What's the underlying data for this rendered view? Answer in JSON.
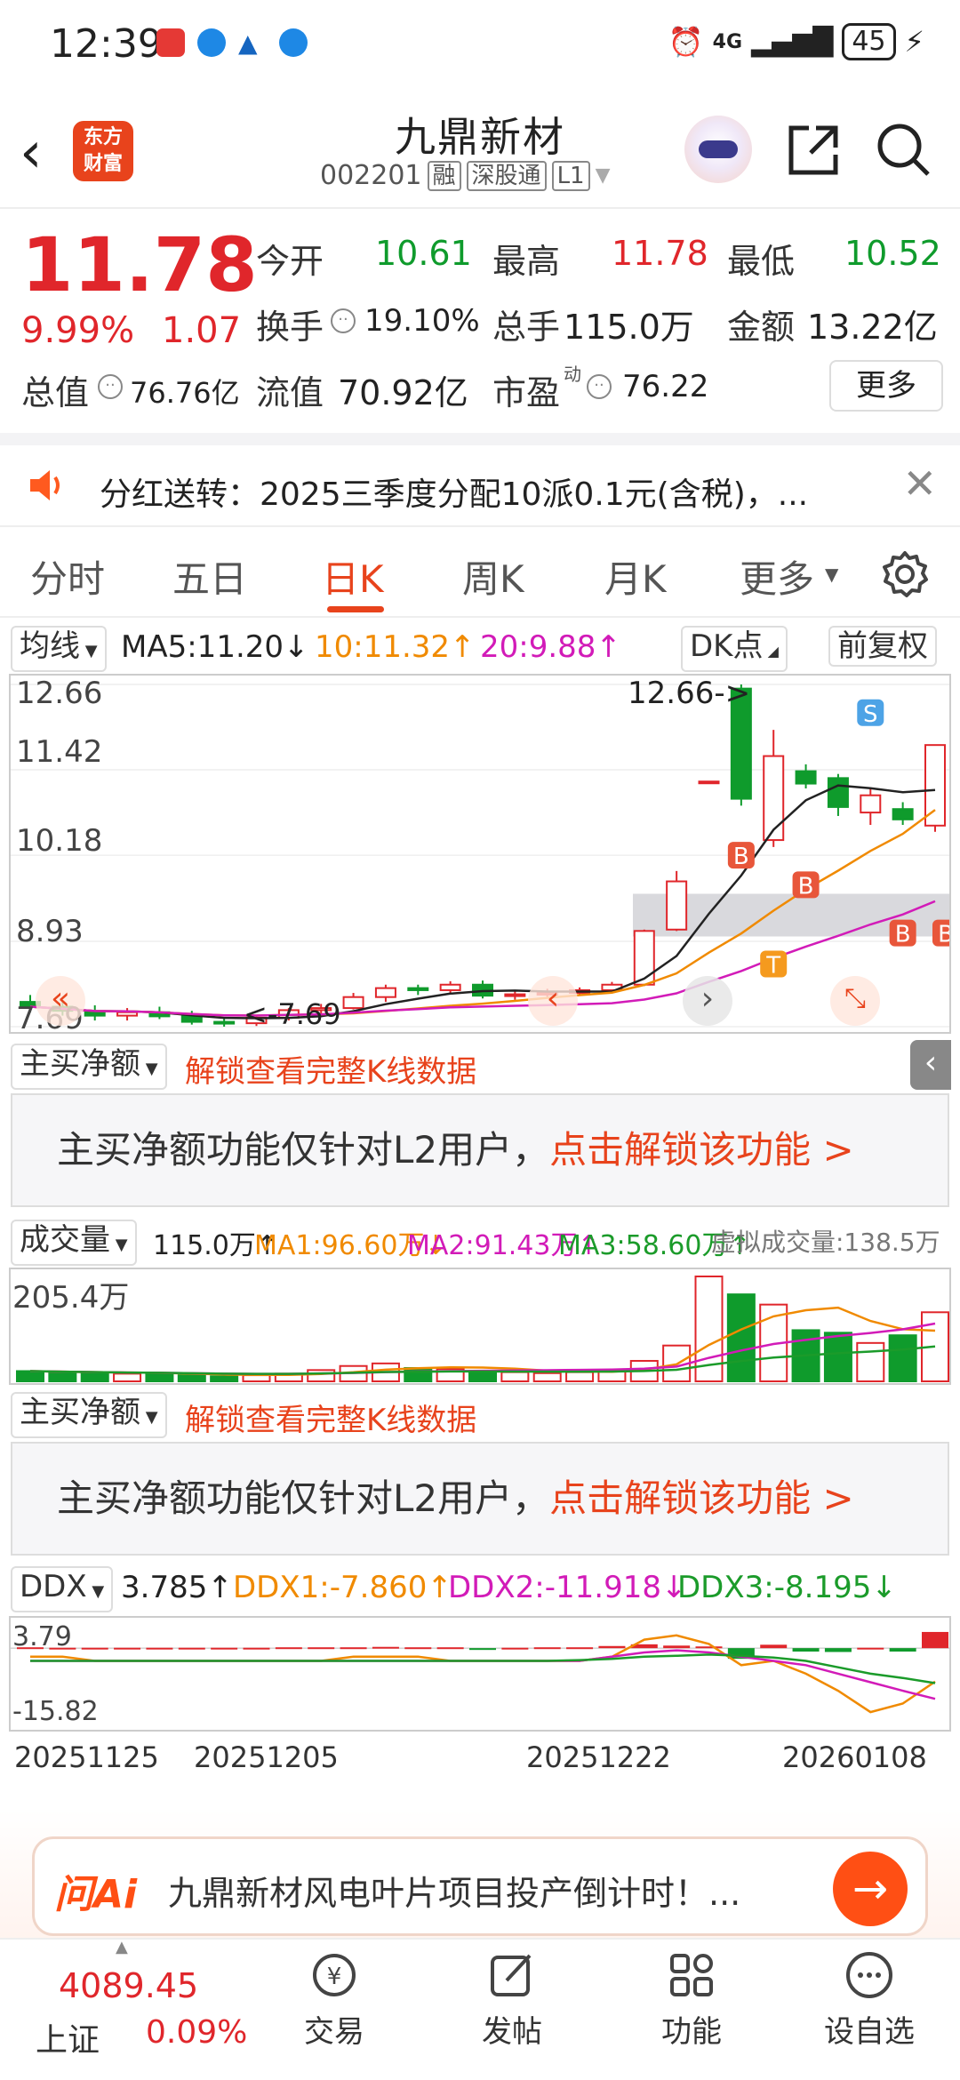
{
  "status_bar": {
    "time": "12:39",
    "network": "4G",
    "battery": "45"
  },
  "header": {
    "title": "九鼎新材",
    "code": "002201",
    "tags": [
      "融",
      "深股通",
      "L1"
    ],
    "logo_text": "东方\n财富"
  },
  "quote": {
    "price": "11.78",
    "change_pct": "9.99%",
    "change": "1.07",
    "open_label": "今开",
    "open": "10.61",
    "high_label": "最高",
    "high": "11.78",
    "low_label": "最低",
    "low": "10.52",
    "turnover_label": "换手",
    "turnover": "19.10%",
    "volume_label": "总手",
    "volume": "115.0万",
    "amount_label": "金额",
    "amount": "13.22亿",
    "mktcap_label": "总值",
    "mktcap": "76.76亿",
    "float_label": "流值",
    "float_cap": "70.92亿",
    "pe_label": "市盈",
    "pe_sup": "动",
    "pe": "76.22",
    "more_label": "更多"
  },
  "dividend": {
    "text": "分红送转：2025三季度分配10派0.1元(含税)，..."
  },
  "tabs": [
    {
      "label": "分时"
    },
    {
      "label": "五日"
    },
    {
      "label": "日K"
    },
    {
      "label": "周K"
    },
    {
      "label": "月K"
    },
    {
      "label": "更多"
    }
  ],
  "ma": {
    "selector": "均线",
    "ma5": "MA5:11.20↓",
    "ma10": "10:11.32↑",
    "ma20": "20:9.88↑",
    "dk_label": "DK点",
    "adjust_label": "前复权"
  },
  "kchart": {
    "y_ticks": [
      "12.66",
      "11.42",
      "10.18",
      "8.93",
      "7.69"
    ],
    "high_annotation": "12.66->",
    "low_annotation": "<-7.69",
    "markers": [
      "B",
      "B",
      "B",
      "S",
      "T",
      "B"
    ]
  },
  "main_net": {
    "selector": "主买净额",
    "unlock_link": "解锁查看完整K线数据",
    "panel_text": "主买净额功能仅针对L2用户，",
    "panel_link": "点击解锁该功能 >"
  },
  "volume": {
    "selector": "成交量",
    "value": "115.0万↑",
    "ma1": "MA1:96.60万↓",
    "ma2": "MA2:91.43万↑",
    "ma3": "MA3:58.60万↑",
    "virtual": "虚拟成交量:138.5万",
    "y_top": "205.4万"
  },
  "main_net2": {
    "selector": "主买净额",
    "unlock_link": "解锁查看完整K线数据",
    "panel_text": "主买净额功能仅针对L2用户，",
    "panel_link": "点击解锁该功能 >"
  },
  "ddx": {
    "selector": "DDX",
    "value": "3.785↑",
    "ddx1": "DDX1:-7.860↑",
    "ddx2": "DDX2:-11.918↓",
    "ddx3": "DDX3:-8.195↓",
    "y_top": "3.79",
    "y_bottom": "-15.82",
    "dates": [
      "20251125",
      "20251205",
      "20251222",
      "20260108"
    ]
  },
  "ai_bar": {
    "logo": "问Ai",
    "text": "九鼎新材风电叶片项目投产倒计时！..."
  },
  "bottom_nav": {
    "index_value": "4089.45",
    "index_name": "上证",
    "index_pct": "0.09%",
    "items": [
      {
        "label": "交易"
      },
      {
        "label": "发帖"
      },
      {
        "label": "功能"
      },
      {
        "label": "设自选"
      }
    ]
  },
  "colors": {
    "up": "#e0262b",
    "down": "#0f9b2c",
    "accent": "#e8431c",
    "ma10": "#f08a00",
    "ma20": "#d21bb8"
  },
  "chart_data": {
    "type": "candlestick",
    "y_range": [
      7.69,
      12.66
    ],
    "price_ticks": [
      12.66,
      11.42,
      10.18,
      8.93,
      7.69
    ],
    "candles": [
      {
        "o": 8.05,
        "h": 8.15,
        "l": 7.9,
        "c": 7.98
      },
      {
        "o": 7.98,
        "h": 8.06,
        "l": 7.85,
        "c": 7.92
      },
      {
        "o": 7.9,
        "h": 8.0,
        "l": 7.78,
        "c": 7.85
      },
      {
        "o": 7.85,
        "h": 7.96,
        "l": 7.78,
        "c": 7.9
      },
      {
        "o": 7.9,
        "h": 7.98,
        "l": 7.8,
        "c": 7.84
      },
      {
        "o": 7.84,
        "h": 7.92,
        "l": 7.72,
        "c": 7.76
      },
      {
        "o": 7.76,
        "h": 7.82,
        "l": 7.69,
        "c": 7.74
      },
      {
        "o": 7.74,
        "h": 7.85,
        "l": 7.7,
        "c": 7.82
      },
      {
        "o": 7.82,
        "h": 7.96,
        "l": 7.78,
        "c": 7.93
      },
      {
        "o": 7.93,
        "h": 8.02,
        "l": 7.86,
        "c": 7.96
      },
      {
        "o": 7.96,
        "h": 8.18,
        "l": 7.94,
        "c": 8.12
      },
      {
        "o": 8.12,
        "h": 8.3,
        "l": 8.05,
        "c": 8.25
      },
      {
        "o": 8.25,
        "h": 8.3,
        "l": 8.15,
        "c": 8.22
      },
      {
        "o": 8.22,
        "h": 8.35,
        "l": 8.18,
        "c": 8.3
      },
      {
        "o": 8.3,
        "h": 8.36,
        "l": 8.1,
        "c": 8.14
      },
      {
        "o": 8.14,
        "h": 8.2,
        "l": 8.08,
        "c": 8.16
      },
      {
        "o": 8.16,
        "h": 8.24,
        "l": 8.12,
        "c": 8.18
      },
      {
        "o": 8.18,
        "h": 8.26,
        "l": 8.14,
        "c": 8.22
      },
      {
        "o": 8.22,
        "h": 8.34,
        "l": 8.2,
        "c": 8.3
      },
      {
        "o": 8.3,
        "h": 9.1,
        "l": 8.28,
        "c": 9.08
      },
      {
        "o": 9.1,
        "h": 9.95,
        "l": 9.08,
        "c": 9.8
      },
      {
        "o": 11.25,
        "h": 11.25,
        "l": 11.25,
        "c": 11.25
      },
      {
        "o": 12.6,
        "h": 12.66,
        "l": 10.9,
        "c": 11.0
      },
      {
        "o": 10.4,
        "h": 12.0,
        "l": 10.3,
        "c": 11.62
      },
      {
        "o": 11.4,
        "h": 11.5,
        "l": 11.15,
        "c": 11.22
      },
      {
        "o": 11.3,
        "h": 11.36,
        "l": 10.75,
        "c": 10.88
      },
      {
        "o": 10.8,
        "h": 11.15,
        "l": 10.62,
        "c": 11.05
      },
      {
        "o": 10.85,
        "h": 10.95,
        "l": 10.62,
        "c": 10.7
      },
      {
        "o": 10.61,
        "h": 11.78,
        "l": 10.52,
        "c": 11.78
      }
    ],
    "volume_y_top": "205.4万",
    "ddx_range": [
      -15.82,
      3.79
    ]
  }
}
